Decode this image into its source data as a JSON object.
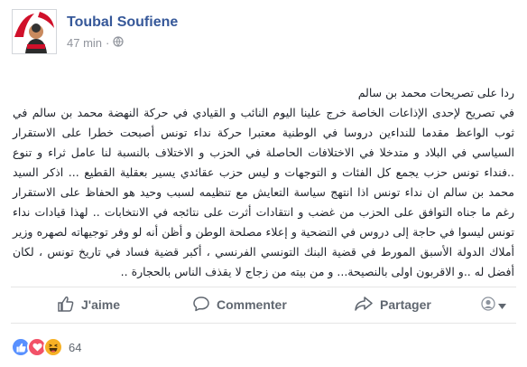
{
  "post": {
    "author": "Toubal Soufiene",
    "time": "47 min",
    "separator": "·",
    "privacy_icon": "globe-icon",
    "avatar_icon": "profile-photo",
    "paragraphs": [
      "ردا على تصريحات محمد بن سالم",
      "في تصريح لإحدى الإذاعات الخاصة خرج علينا اليوم النائب و القيادي في حركة النهضة محمد بن سالم في ثوب الواعظ مقدما للنداءين دروسا في الوطنية معتبرا حركة نداء تونس أصبحت خطرا على الاستقرار السياسي في البلاد و متدخلا في الاختلافات الحاصلة في الحزب و الاختلاف بالنسبة لنا عامل ثراء و تنوع ..فنداء تونس حزب يجمع كل الفئات و التوجهات و ليس حزب عقائدي يسير بعقلية القطيع ... اذكر السيد محمد بن سالم ان نداء تونس اذا انتهج سياسة التعايش مع تنظيمه لسبب وحيد هو الحفاظ على الاستقرار رغم ما جناه التوافق على الحزب من غضب و انتقادات أثرت على نتائجه في الانتخابات .. لهذا قيادات نداء تونس ليسوا في حاجة إلى دروس في التضحية و إعلاء مصلحة الوطن و أظن أنه لو وفر توجيهاته لصهره وزير أملاك الدولة الأسبق المورط في قضية البنك التونسي الفرنسي ، أكبر قضية فساد في تاريخ تونس ، لكان أفضل له ..و الاقربون اولى بالنصيحة... و من بيته من زجاج لا يقذف الناس بالحجارة .."
    ]
  },
  "actions": {
    "like": "J'aime",
    "comment": "Commenter",
    "share": "Partager"
  },
  "reactions": {
    "types": [
      "like",
      "love",
      "haha"
    ],
    "count": "64"
  },
  "colors": {
    "author": "#365899",
    "like_blue": "#5890ff",
    "love_red": "#f25268",
    "haha_yellow": "#f7b125"
  }
}
